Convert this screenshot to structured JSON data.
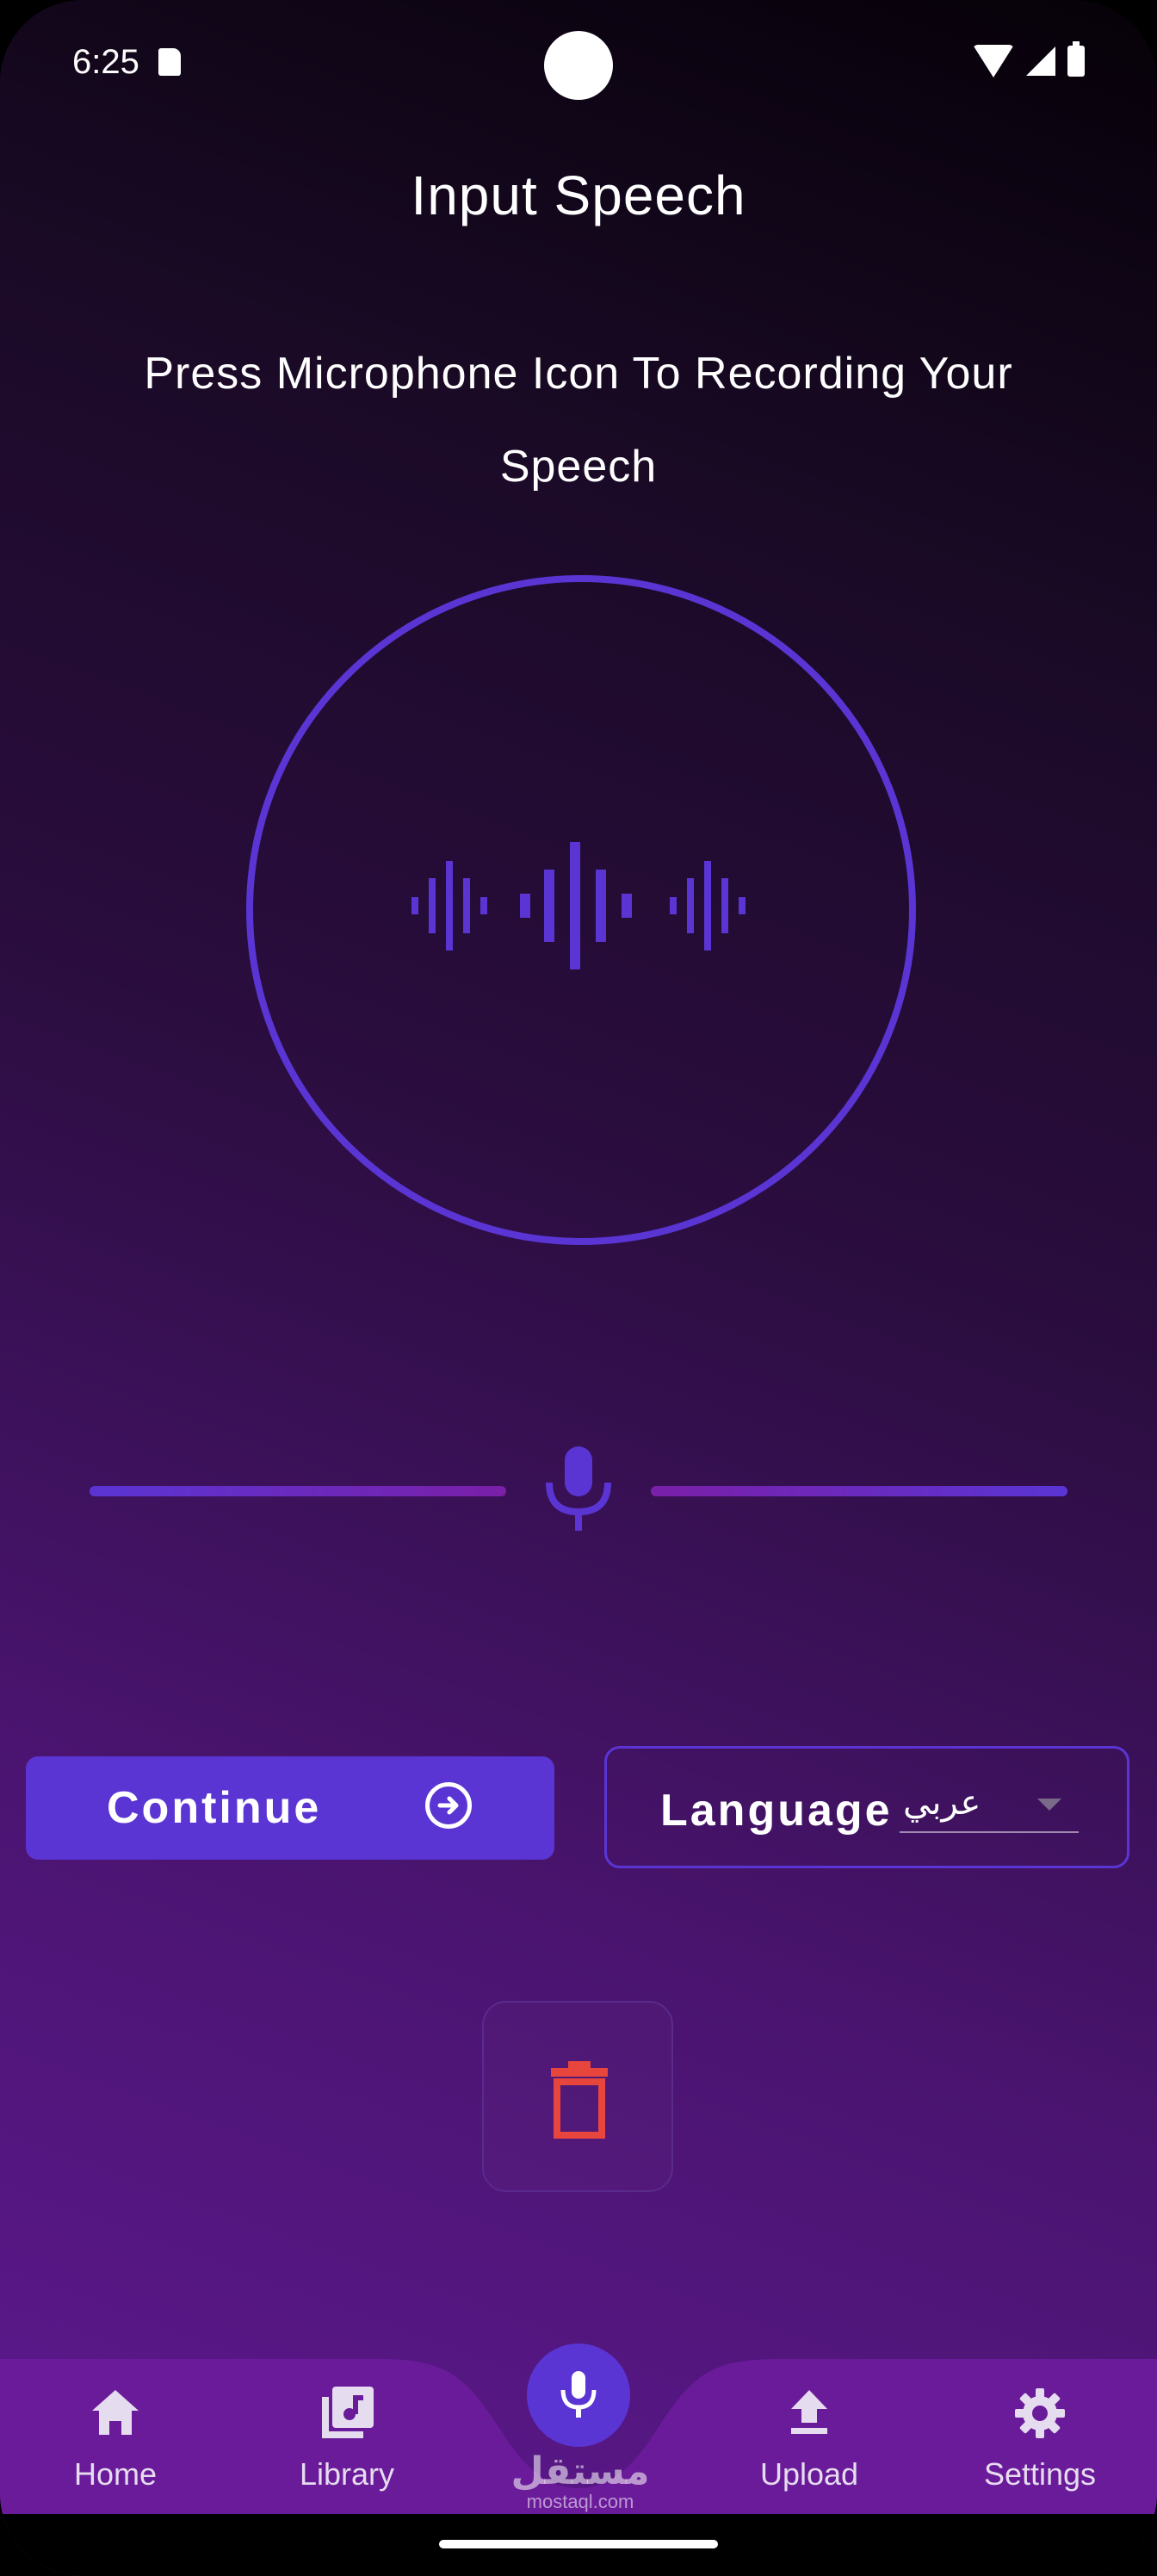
{
  "status_bar": {
    "time": "6:25"
  },
  "header": {
    "title": "Input Speech"
  },
  "instructions": "Press Microphone Icon To Recording Your Speech",
  "actions": {
    "continue_label": "Continue",
    "language_label": "Language",
    "language_value": "عربي"
  },
  "nav": {
    "items": [
      {
        "label": "Home",
        "icon": "home-icon"
      },
      {
        "label": "Library",
        "icon": "library-music-icon"
      },
      {
        "label": "Upload",
        "icon": "upload-icon"
      },
      {
        "label": "Settings",
        "icon": "gear-icon"
      }
    ],
    "center_icon": "microphone-icon"
  },
  "watermark": {
    "arabic": "مستقل",
    "latin": "mostaql.com"
  },
  "colors": {
    "accent": "#5a35d4",
    "delete": "#e8453c",
    "nav_background": "#6a1b9a"
  }
}
